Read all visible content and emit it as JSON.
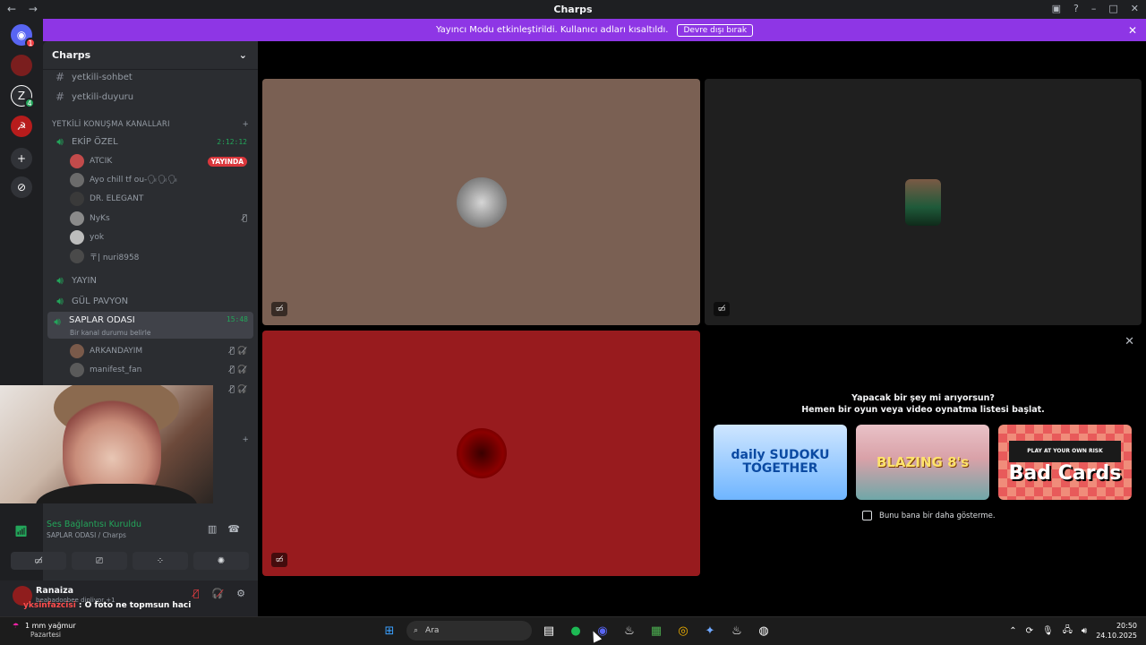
{
  "window": {
    "title": "Charps",
    "nav_back": "←",
    "nav_forward": "→"
  },
  "banner": {
    "text": "Yayıncı Modu etkinleştirildi. Kullanıcı adları kısaltıldı.",
    "button": "Devre dışı bırak",
    "close": "✕"
  },
  "rail": {
    "badges": [
      "1",
      "4"
    ]
  },
  "sidebar": {
    "server_name": "Charps",
    "channels_top": [
      {
        "name": "yetkili-sohbet"
      },
      {
        "name": "yetkili-duyuru"
      }
    ],
    "category": "YETKİLİ KONUŞMA KANALLARI",
    "category_add": "+",
    "ekip": {
      "name": "EKİP ÖZEL",
      "timer": "2:12:12"
    },
    "ekip_users": [
      {
        "name": "ATCIK",
        "badge": "YAYINDA"
      },
      {
        "name": "Ayo chill tf ou-🗣🗣🗣"
      },
      {
        "name": "DR. ELEGANT"
      },
      {
        "name": "NyKs"
      },
      {
        "name": "yok"
      },
      {
        "name": "〒| nuri8958"
      }
    ],
    "voice_channels": [
      {
        "name": "YAYIN"
      },
      {
        "name": "GÜL PAVYON"
      }
    ],
    "active_channel": {
      "name": "SAPLAR ODASI",
      "timer": "15:48",
      "status": "Bir kanal durumu belirle"
    },
    "active_users": [
      {
        "name": "ARKANDAYIM"
      },
      {
        "name": "manifest_fan"
      }
    ],
    "plus": "+"
  },
  "voice": {
    "status": "Ses Bağlantısı Kuruldu",
    "location": "SAPLAR ODASI / Charps"
  },
  "user_panel": {
    "name": "Ranaiza",
    "status": "beabadoobee dinliyor +1"
  },
  "chat_overlay": {
    "name": "yksinfazcisi",
    "message": " : O foto ne topmsun haci"
  },
  "activity": {
    "question": "Yapacak bir şey mi arıyorsun?",
    "subtitle": "Hemen bir oyun veya video oynatma listesi başlat.",
    "cards": [
      {
        "title": "daily SUDOKU TOGETHER"
      },
      {
        "title": "BLAZING 8's"
      },
      {
        "title": "Bad Cards",
        "tag": "PLAY AT YOUR OWN RISK"
      }
    ],
    "dont_show": "Bunu bana bir daha gösterme."
  },
  "tiles": {
    "colors": [
      "#7a6053",
      "#1f1f1f",
      "#981b1e"
    ]
  },
  "taskbar": {
    "weather": "1 mm yağmur",
    "day": "Pazartesi",
    "search": "Ara",
    "time": "20:50",
    "date": "24.10.2025",
    "discord_badge": "1"
  },
  "colors": {
    "accent_banner": "#8e36e5",
    "voice_green": "#23a55a",
    "live_red": "#da373c"
  }
}
